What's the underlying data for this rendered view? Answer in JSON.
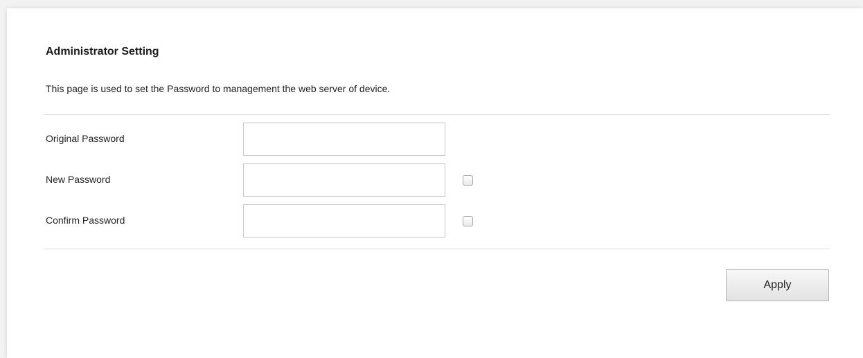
{
  "page": {
    "title": "Administrator Setting",
    "description": "This page is used to set the Password to management the web server of device."
  },
  "form": {
    "fields": [
      {
        "label": "Original Password",
        "value": "",
        "has_checkbox": false
      },
      {
        "label": "New Password",
        "value": "",
        "has_checkbox": true,
        "checked": false
      },
      {
        "label": "Confirm Password",
        "value": "",
        "has_checkbox": true,
        "checked": false
      }
    ],
    "apply_label": "Apply"
  },
  "colors": {
    "background": "#f2f2f2",
    "panel": "#ffffff",
    "divider": "#dcdcdc",
    "input_border": "#c8c8c8"
  }
}
